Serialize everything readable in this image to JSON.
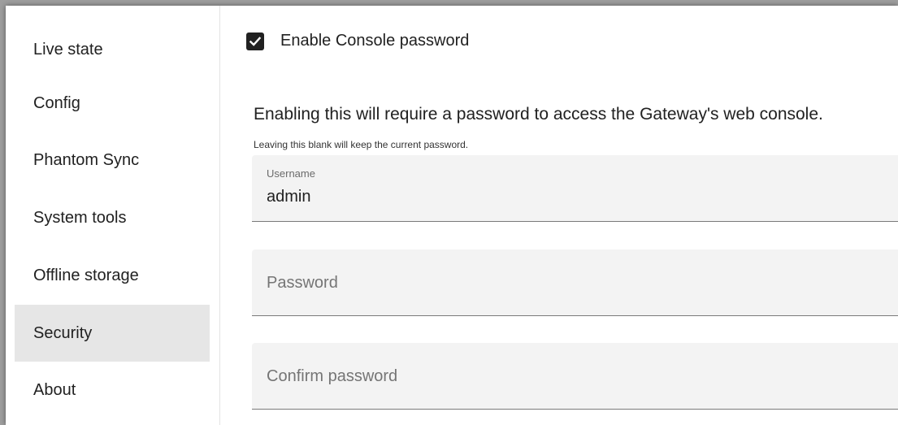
{
  "sidebar": {
    "items": [
      {
        "label": "Live state"
      },
      {
        "label": "Config"
      },
      {
        "label": "Phantom Sync"
      },
      {
        "label": "System tools"
      },
      {
        "label": "Offline storage"
      },
      {
        "label": "Security",
        "active": true
      },
      {
        "label": "About"
      }
    ]
  },
  "security": {
    "enable_console_password": {
      "label": "Enable Console password",
      "checked": true
    },
    "description": "Enabling this will require a password to access the Gateway's web console.",
    "hint": "Leaving this blank will keep the current password.",
    "username": {
      "label": "Username",
      "value": "admin"
    },
    "password": {
      "placeholder": "Password"
    },
    "confirm_password": {
      "placeholder": "Confirm password"
    }
  },
  "colors": {
    "active_item_bg": "#e6e6e6",
    "checkbox_fill": "#212121",
    "field_bg": "#f3f3f3"
  }
}
